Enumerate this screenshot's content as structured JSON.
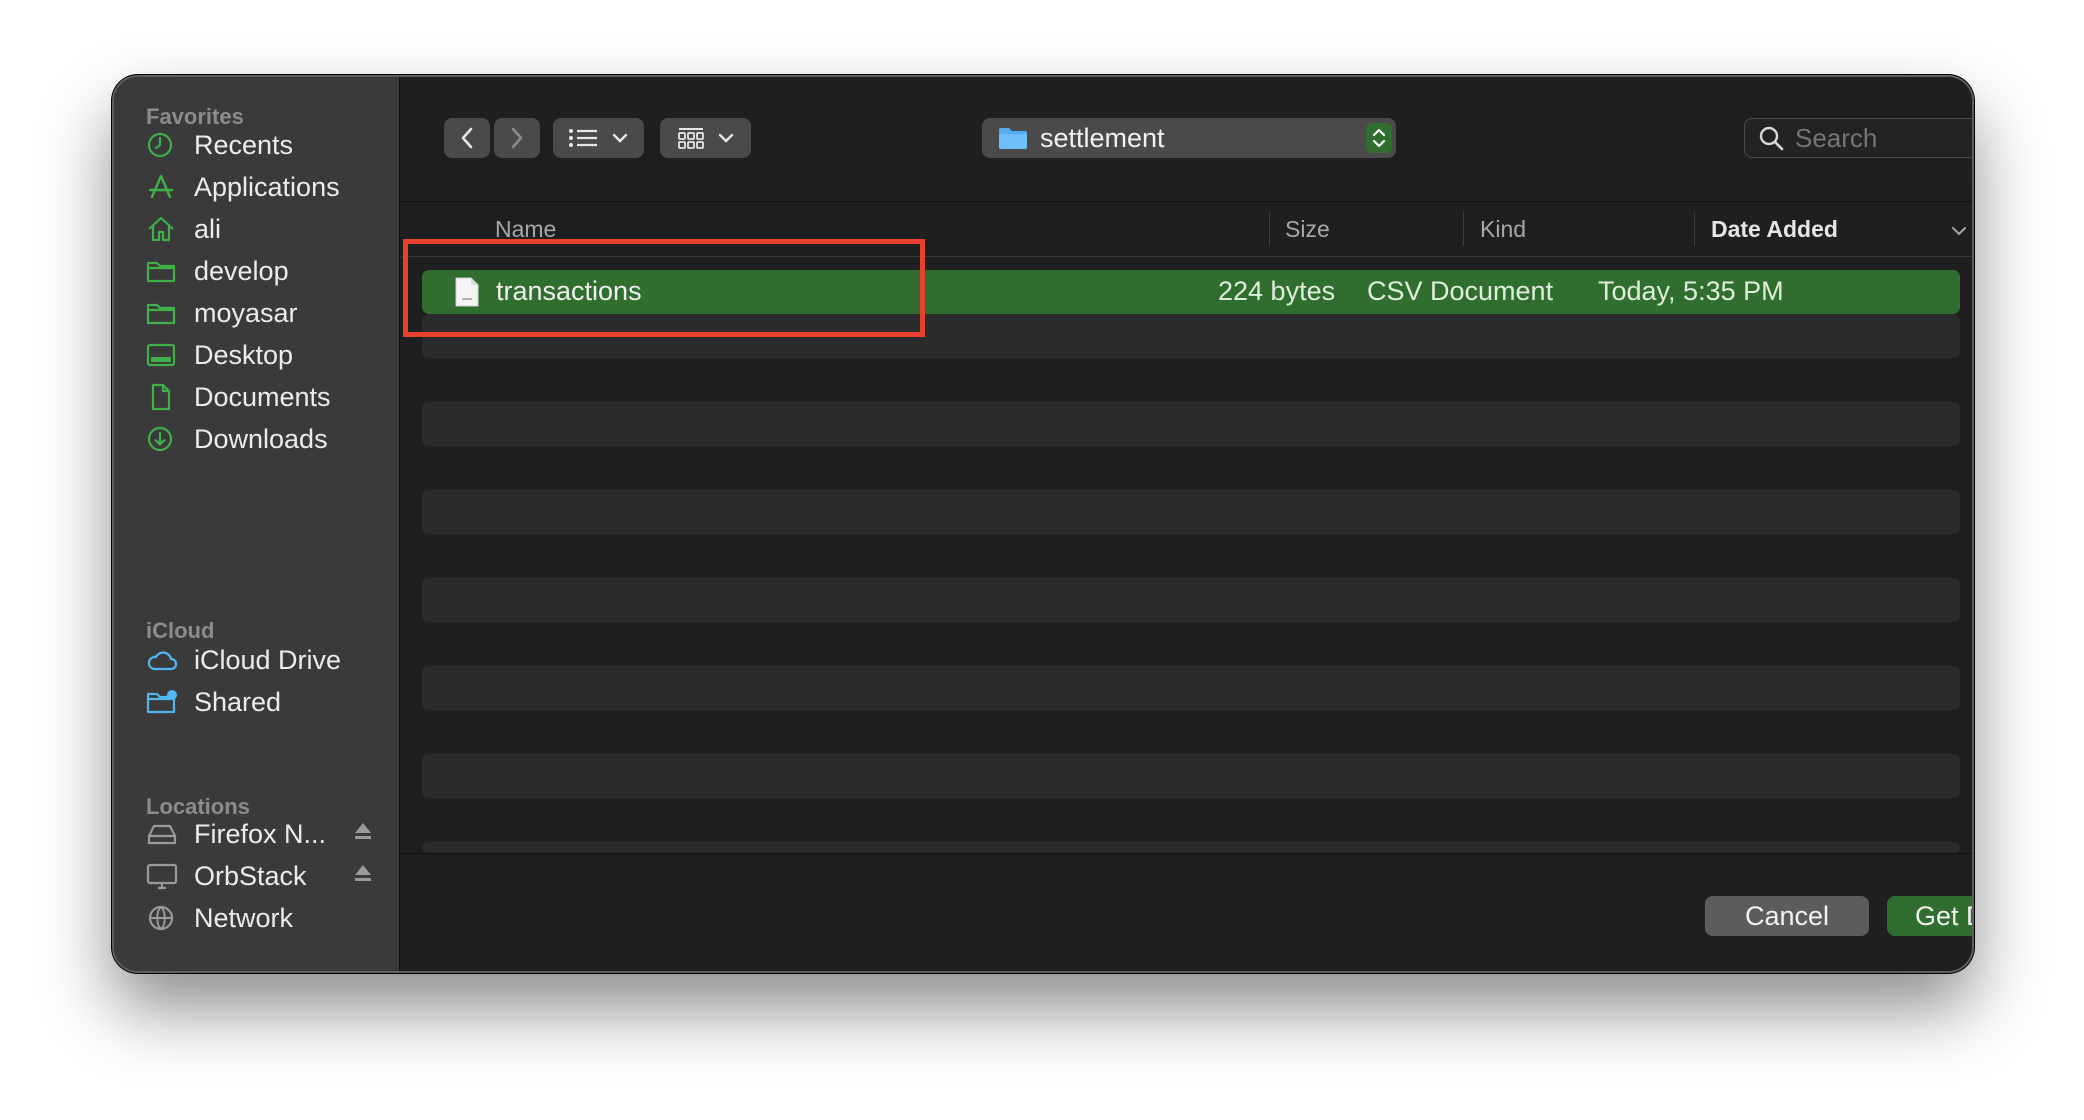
{
  "sidebar": {
    "favorites_header": "Favorites",
    "favorites": [
      {
        "label": "Recents",
        "icon": "clock-icon"
      },
      {
        "label": "Applications",
        "icon": "applications-icon"
      },
      {
        "label": "ali",
        "icon": "home-icon"
      },
      {
        "label": "develop",
        "icon": "folder-icon"
      },
      {
        "label": "moyasar",
        "icon": "folder-icon"
      },
      {
        "label": "Desktop",
        "icon": "desktop-icon"
      },
      {
        "label": "Documents",
        "icon": "document-icon"
      },
      {
        "label": "Downloads",
        "icon": "download-icon"
      }
    ],
    "icloud_header": "iCloud",
    "icloud": [
      {
        "label": "iCloud Drive",
        "icon": "cloud-icon"
      },
      {
        "label": "Shared",
        "icon": "shared-folder-icon"
      }
    ],
    "locations_header": "Locations",
    "locations": [
      {
        "label": "Firefox N...",
        "icon": "drive-icon"
      },
      {
        "label": "OrbStack",
        "icon": "monitor-icon"
      },
      {
        "label": "Network",
        "icon": "globe-icon"
      }
    ]
  },
  "toolbar": {
    "current_folder": "settlement",
    "search_placeholder": "Search"
  },
  "columns": {
    "name": "Name",
    "size": "Size",
    "kind": "Kind",
    "date_added": "Date Added"
  },
  "files": [
    {
      "name": "transactions",
      "size": "224 bytes",
      "kind": "CSV Document",
      "date_added": "Today, 5:35 PM",
      "selected": true
    }
  ],
  "footer": {
    "cancel_label": "Cancel",
    "confirm_label": "Get Data"
  },
  "colors": {
    "accent": "#2f6e2f",
    "sidebar_icon": "#3fb04a",
    "icloud_icon": "#52b7f0",
    "highlight": "#e8402e"
  }
}
